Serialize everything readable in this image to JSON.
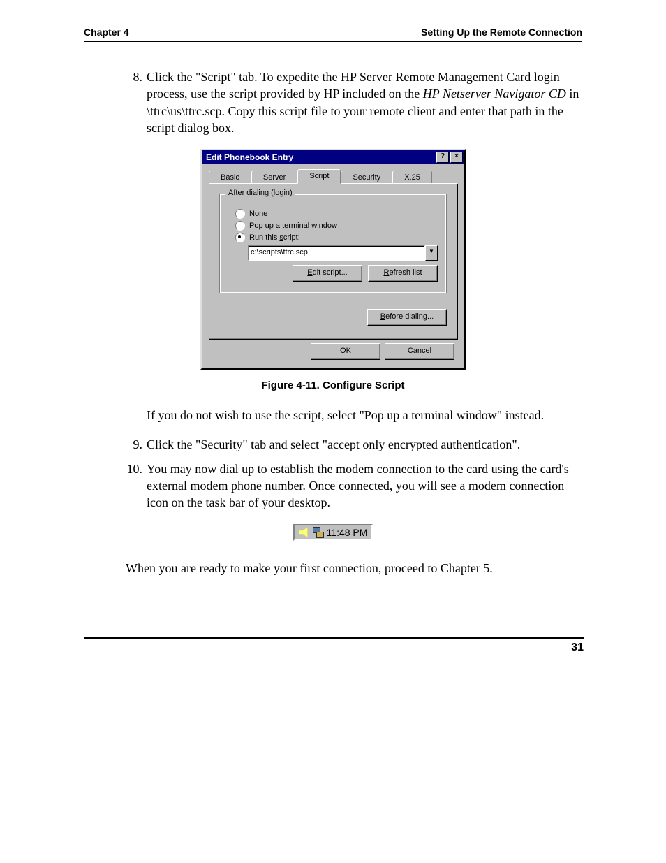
{
  "header": {
    "left": "Chapter 4",
    "right": "Setting Up the Remote Connection"
  },
  "steps": {
    "s8": {
      "num": "8.",
      "a": "Click the \"Script\" tab. To expedite the HP Server Remote Management Card login process, use the script provided by HP included on the ",
      "b": "HP Netserver Navigator CD",
      "c": " in \\ttrc\\us\\ttrc.scp. Copy this script file to your remote client and enter that path in the script dialog box."
    },
    "s9": {
      "num": "9.",
      "text": "Click the \"Security\" tab and select \"accept only encrypted authentication\"."
    },
    "s10": {
      "num": "10.",
      "text": "You may now dial up to establish the modem connection to the card using the card's external modem phone number. Once connected, you will see a modem connection icon on the task bar of your desktop."
    }
  },
  "dialog": {
    "title": "Edit Phonebook Entry",
    "help": "?",
    "close": "×",
    "tabs": {
      "basic": "Basic",
      "server": "Server",
      "script": "Script",
      "security": "Security",
      "x25": "X.25"
    },
    "group_legend": "After dialing (login)",
    "radios": {
      "none": {
        "pre": "",
        "u": "N",
        "post": "one"
      },
      "popup": {
        "pre": "Pop up a ",
        "u": "t",
        "post": "erminal window"
      },
      "run": {
        "pre": "Run this ",
        "u": "s",
        "post": "cript:"
      }
    },
    "script_path": "c:\\scripts\\ttrc.scp",
    "buttons": {
      "edit": {
        "u": "E",
        "post": "dit script..."
      },
      "refresh": {
        "u": "R",
        "post": "efresh list"
      },
      "before": {
        "u": "B",
        "post": "efore dialing..."
      },
      "ok": "OK",
      "cancel": "Cancel"
    }
  },
  "caption": "Figure 4-11.  Configure Script",
  "post_fig_para": "If you do not wish to use the script, select \"Pop up a terminal window\" instead.",
  "tray_time": "11:48 PM",
  "closing": "When you are ready to make your first connection, proceed to Chapter 5.",
  "page_number": "31"
}
